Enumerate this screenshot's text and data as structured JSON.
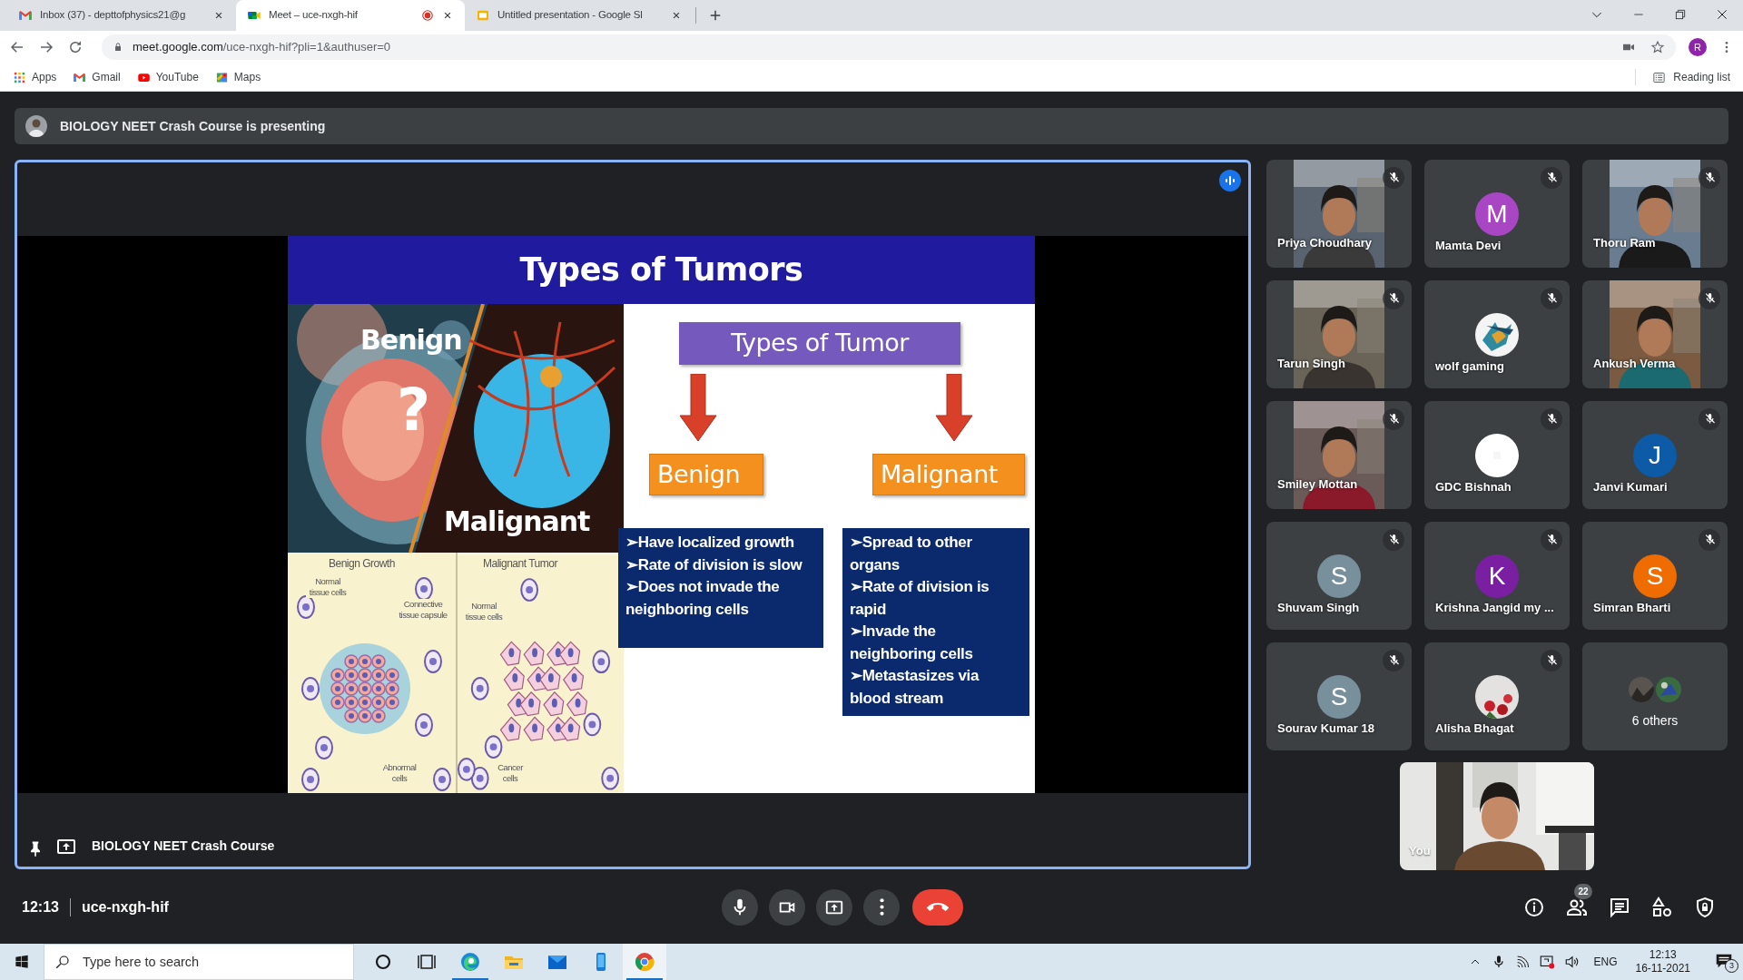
{
  "browser": {
    "tabs": [
      {
        "kind": "gmail",
        "title": "Inbox (37) - depttofphysics21@g",
        "selected": false,
        "recording": false
      },
      {
        "kind": "meet",
        "title": "Meet – uce-nxgh-hif",
        "selected": true,
        "recording": true
      },
      {
        "kind": "slides",
        "title": "Untitled presentation - Google Sl",
        "selected": false,
        "recording": false
      }
    ],
    "url_host": "meet.google.com",
    "url_path": "/uce-nxgh-hif?pli=1&authuser=0",
    "profile_initial": "R",
    "bookmarks": [
      {
        "kind": "apps",
        "label": "Apps"
      },
      {
        "kind": "gmail",
        "label": "Gmail"
      },
      {
        "kind": "youtube",
        "label": "YouTube"
      },
      {
        "kind": "maps",
        "label": "Maps"
      }
    ],
    "reading_list": "Reading list"
  },
  "meet": {
    "presenting_banner": "BIOLOGY NEET Crash Course is presenting",
    "presenter_label": "BIOLOGY NEET Crash Course",
    "slide": {
      "title": "Types of Tumors",
      "photo_labels": [
        "Benign",
        "?",
        "Malignant"
      ],
      "diagram_titles": [
        "Benign Growth",
        "Malignant Tumor"
      ],
      "diagram_labels": [
        "Normal tissue cells",
        "Connective tissue capsule",
        "Abnormal cells",
        "Normal tissue cells",
        "Cancer cells"
      ],
      "chart_heading": "Types of Tumor",
      "branches": [
        {
          "label": "Benign",
          "points": [
            "➢Have localized growth",
            "➢Rate of division is slow",
            "➢Does not invade the neighboring cells"
          ]
        },
        {
          "label": "Malignant",
          "points": [
            "➢Spread to other organs",
            "➢Rate of division is rapid",
            "➢Invade the neighboring cells",
            "➢Metastasizes via blood stream"
          ]
        }
      ]
    },
    "participants": [
      {
        "name": "Priya Choudhary",
        "kind": "video",
        "muted": true
      },
      {
        "name": "Mamta Devi",
        "kind": "avatar",
        "initial": "M",
        "color": "#a846c4",
        "muted": true
      },
      {
        "name": "Thoru Ram",
        "kind": "video",
        "muted": true
      },
      {
        "name": "Tarun Singh",
        "kind": "video",
        "muted": true
      },
      {
        "name": "wolf gaming",
        "muted": true
      },
      {
        "name": "Ankush Verma",
        "kind": "video",
        "muted": true
      },
      {
        "name": "Smiley Mottan",
        "kind": "video",
        "muted": true
      },
      {
        "name": "GDC Bishnah",
        "muted": true
      },
      {
        "name": "Janvi Kumari",
        "kind": "avatar",
        "initial": "J",
        "color": "#0d5aa7",
        "muted": true
      },
      {
        "name": "Shuvam Singh",
        "kind": "avatar",
        "initial": "S",
        "color": "#78909c",
        "muted": true
      },
      {
        "name": "Krishna Jangid my ...",
        "kind": "avatar",
        "initial": "K",
        "color": "#7b1fa2",
        "muted": true
      },
      {
        "name": "Simran Bharti",
        "kind": "avatar",
        "initial": "S",
        "color": "#ef6c00",
        "muted": true
      },
      {
        "name": "Sourav Kumar 18",
        "kind": "avatar",
        "initial": "S",
        "color": "#78909c",
        "muted": true
      },
      {
        "name": "Alisha Bhagat",
        "muted": true
      }
    ],
    "others": "6 others",
    "self_label": "You",
    "time": "12:13",
    "meeting_code": "uce-nxgh-hif",
    "people_count": "22"
  },
  "taskbar": {
    "search_placeholder": "Type here to search",
    "apps": [
      {
        "kind": "cortana",
        "running": false,
        "selected": false
      },
      {
        "kind": "taskview",
        "running": false,
        "selected": false
      },
      {
        "kind": "edge",
        "running": true,
        "selected": false
      },
      {
        "kind": "explorer",
        "running": false,
        "selected": false
      },
      {
        "kind": "mail",
        "running": false,
        "selected": false
      },
      {
        "kind": "phone",
        "running": false,
        "selected": false
      },
      {
        "kind": "chrome",
        "running": true,
        "selected": true
      }
    ],
    "language": "ENG",
    "time": "12:13",
    "date": "16-11-2021",
    "notifications": "3"
  }
}
